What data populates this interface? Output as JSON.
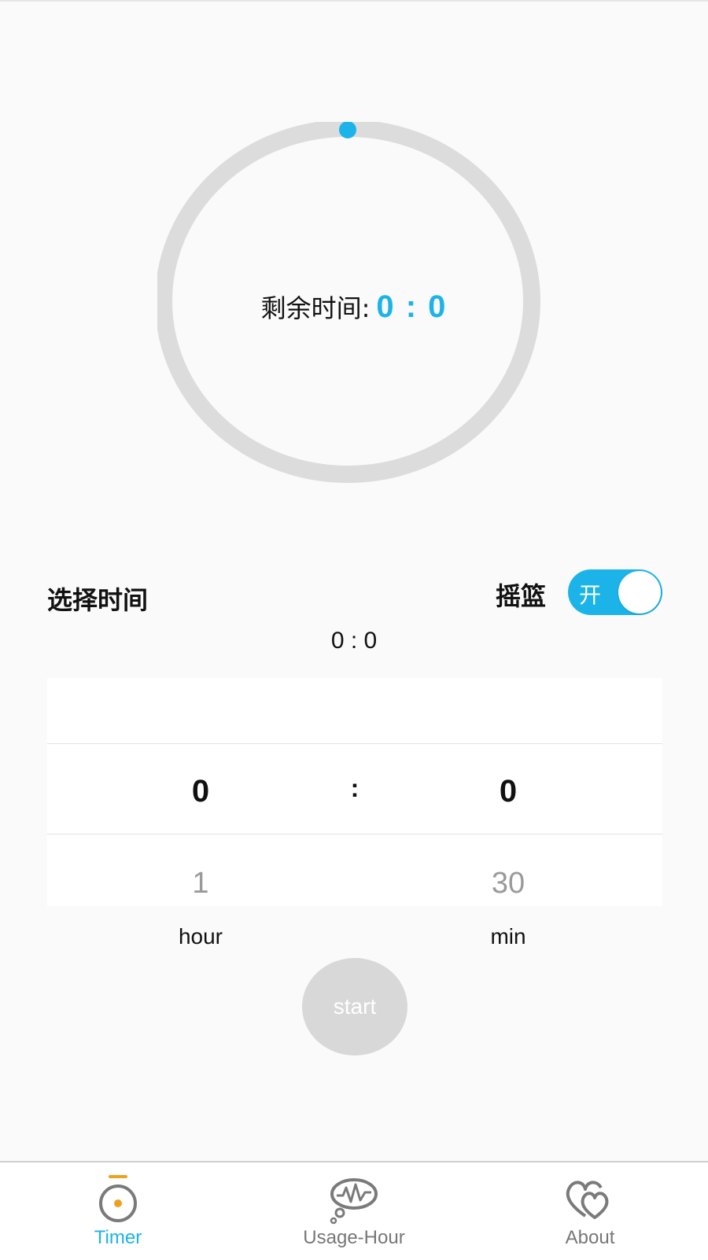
{
  "timer": {
    "remaining_label": "剩余时间:",
    "remaining_value": "0 : 0",
    "progress_fraction": 0
  },
  "selector": {
    "title": "选择时间",
    "cradle_label": "摇篮",
    "toggle_text": "开",
    "toggle_on": true,
    "picked_time": "0 : 0"
  },
  "picker": {
    "hour_selected": "0",
    "hour_next": "1",
    "separator": ":",
    "min_selected": "0",
    "min_next": "30",
    "hour_unit": "hour",
    "min_unit": "min"
  },
  "start_button": {
    "label": "start"
  },
  "nav": {
    "items": [
      {
        "label": "Timer",
        "icon": "timer-icon",
        "active": true
      },
      {
        "label": "Usage-Hour",
        "icon": "usage-thought-bubble-icon",
        "active": false
      },
      {
        "label": "About",
        "icon": "hearts-icon",
        "active": false
      }
    ]
  },
  "colors": {
    "accent": "#1cb4e8",
    "ring_track": "#dcdcdc",
    "timer_icon_orange": "#f0a020",
    "button_disabled": "#d8d8d8"
  }
}
